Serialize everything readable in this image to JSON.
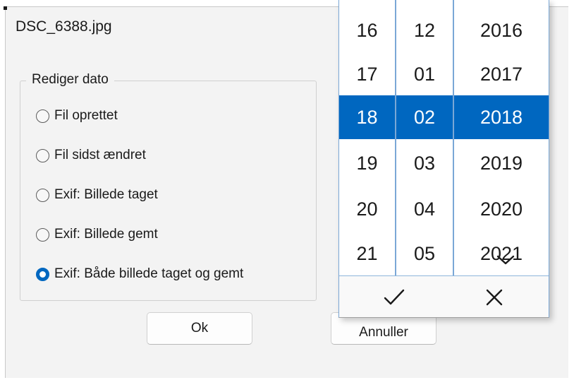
{
  "dialog": {
    "filename": "DSC_6388.jpg"
  },
  "group": {
    "legend": "Rediger dato",
    "options": [
      {
        "label": "Fil oprettet",
        "checked": false
      },
      {
        "label": "Fil sidst ændret",
        "checked": false
      },
      {
        "label": "Exif: Billede taget",
        "checked": false
      },
      {
        "label": "Exif: Billede gemt",
        "checked": false
      },
      {
        "label": "Exif: Både billede taget og gemt",
        "checked": true
      }
    ]
  },
  "buttons": {
    "ok_label": "Ok",
    "cancel_label": "Annuller"
  },
  "picker": {
    "day_column": [
      "16",
      "17",
      "18",
      "19",
      "20",
      "21"
    ],
    "month_column": [
      "12",
      "01",
      "02",
      "03",
      "04",
      "05"
    ],
    "year_column": [
      "2016",
      "2017",
      "2018",
      "2019",
      "2020",
      "2021"
    ],
    "selected": {
      "day": "18",
      "month": "02",
      "year": "2018"
    },
    "accept_icon": "checkmark-icon",
    "dismiss_icon": "close-icon",
    "scroll_icon": "chevron-down-icon"
  },
  "colors": {
    "accent": "#0067c0",
    "dialog_bg": "#f3f3f3",
    "picker_border": "#7aa7d6"
  }
}
